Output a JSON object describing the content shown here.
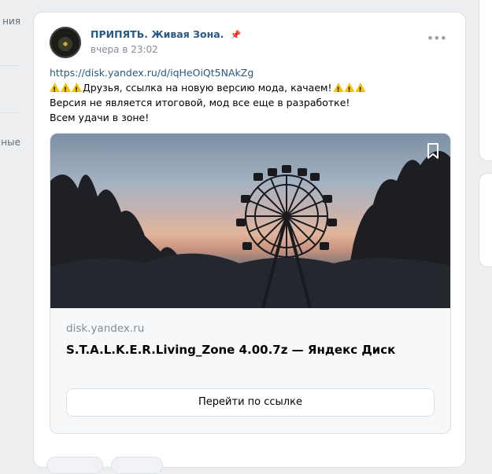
{
  "sidebar": {
    "fragments": [
      "ния",
      "ные"
    ]
  },
  "post": {
    "author": "ПРИПЯТЬ. Живая Зона.",
    "pin_icon": "pin-icon",
    "time": "вчера в 23:02",
    "more_icon": "more-dots-icon",
    "link_url": "https://disk.yandex.ru/d/iqHeOiQt5NAkZg",
    "line1": "Друзья, ссылка на новую версию мода, качаем!",
    "line2": "Версия не является итоговой, мод все еще в разработке!",
    "line3": "Всем удачи в зоне!"
  },
  "attachment": {
    "domain": "disk.yandex.ru",
    "title": "S.T.A.L.K.E.R.Living_Zone 4.00.7z — Яндекс Диск",
    "button_label": "Перейти по ссылке",
    "bookmark_icon": "bookmark-icon"
  },
  "colors": {
    "link": "#2a5885",
    "muted": "#818c99",
    "background": "#edeef0"
  }
}
